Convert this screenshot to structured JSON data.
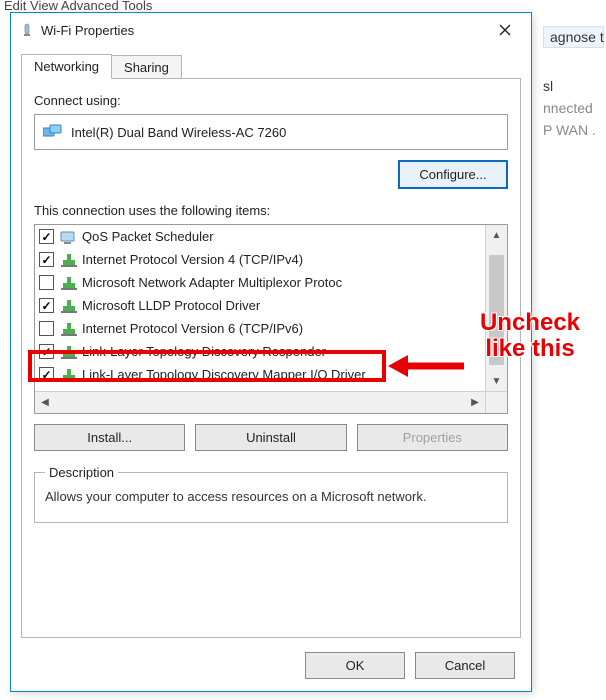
{
  "bg": {
    "menu": "Edit   View   Advanced   Tools",
    "right1": "agnose t",
    "right2": "sl",
    "right3": "nnected",
    "right4": "P WAN ."
  },
  "dialog": {
    "title": "Wi-Fi Properties",
    "tabs": {
      "networking": "Networking",
      "sharing": "Sharing"
    },
    "connect_using": "Connect using:",
    "adapter": "Intel(R) Dual Band Wireless-AC 7260",
    "configure": "Configure...",
    "items_label": "This connection uses the following items:",
    "items": [
      {
        "checked": true,
        "icon": "qos",
        "label": "QoS Packet Scheduler"
      },
      {
        "checked": true,
        "icon": "net",
        "label": "Internet Protocol Version 4 (TCP/IPv4)"
      },
      {
        "checked": false,
        "icon": "net",
        "label": "Microsoft Network Adapter Multiplexor Protoc"
      },
      {
        "checked": true,
        "icon": "net",
        "label": "Microsoft LLDP Protocol Driver"
      },
      {
        "checked": false,
        "icon": "net",
        "label": "Internet Protocol Version 6 (TCP/IPv6)"
      },
      {
        "checked": true,
        "icon": "net",
        "label": "Link-Layer Topology Discovery Responder"
      },
      {
        "checked": true,
        "icon": "net",
        "label": "Link-Layer Topology Discovery Mapper I/O Driver"
      }
    ],
    "install": "Install...",
    "uninstall": "Uninstall",
    "properties": "Properties",
    "description_label": "Description",
    "description_text": "Allows your computer to access resources on a Microsoft network.",
    "ok": "OK",
    "cancel": "Cancel"
  },
  "annotation": {
    "line1": "Uncheck",
    "line2": "like this"
  }
}
